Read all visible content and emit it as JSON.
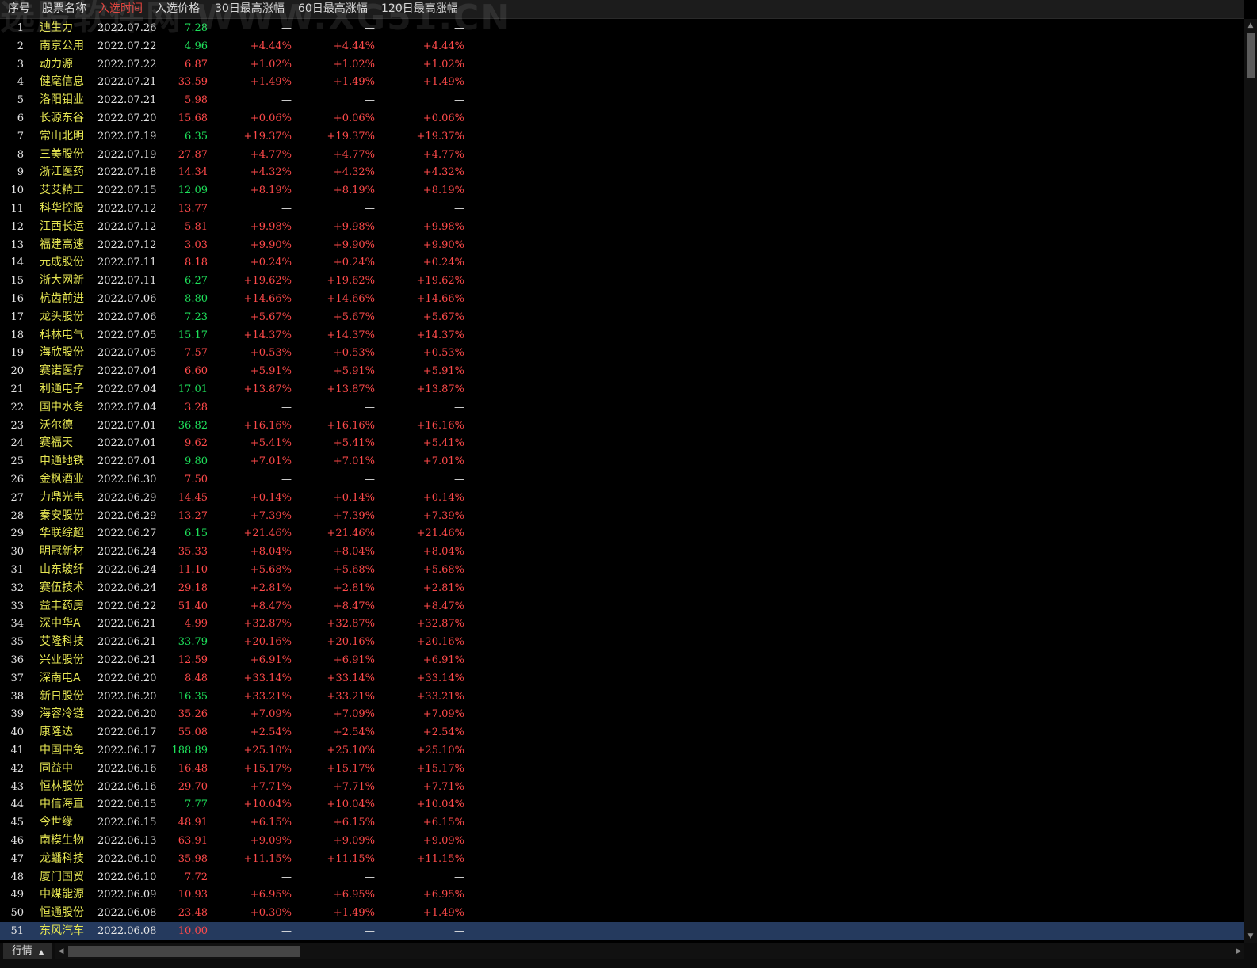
{
  "header": {
    "columns": [
      "序号",
      "股票名称",
      "入选时间",
      "入选价格",
      "30日最高涨幅",
      "60日最高涨幅",
      "120日最高涨幅"
    ],
    "active_column": "入选时间"
  },
  "watermark": "选股软件网 WWW.XG51.CN",
  "rows": [
    {
      "idx": "1",
      "name": "迪生力",
      "date": "2022.07.26",
      "price": "7.28",
      "dir": "down",
      "r30": "—",
      "r60": "—",
      "r120": "—"
    },
    {
      "idx": "2",
      "name": "南京公用",
      "date": "2022.07.22",
      "price": "4.96",
      "dir": "down",
      "r30": "+4.44%",
      "r60": "+4.44%",
      "r120": "+4.44%"
    },
    {
      "idx": "3",
      "name": "动力源",
      "date": "2022.07.22",
      "price": "6.87",
      "dir": "up",
      "r30": "+1.02%",
      "r60": "+1.02%",
      "r120": "+1.02%"
    },
    {
      "idx": "4",
      "name": "健麾信息",
      "date": "2022.07.21",
      "price": "33.59",
      "dir": "up",
      "r30": "+1.49%",
      "r60": "+1.49%",
      "r120": "+1.49%"
    },
    {
      "idx": "5",
      "name": "洛阳钼业",
      "date": "2022.07.21",
      "price": "5.98",
      "dir": "up",
      "r30": "—",
      "r60": "—",
      "r120": "—"
    },
    {
      "idx": "6",
      "name": "长源东谷",
      "date": "2022.07.20",
      "price": "15.68",
      "dir": "up",
      "r30": "+0.06%",
      "r60": "+0.06%",
      "r120": "+0.06%"
    },
    {
      "idx": "7",
      "name": "常山北明",
      "date": "2022.07.19",
      "price": "6.35",
      "dir": "down",
      "r30": "+19.37%",
      "r60": "+19.37%",
      "r120": "+19.37%"
    },
    {
      "idx": "8",
      "name": "三美股份",
      "date": "2022.07.19",
      "price": "27.87",
      "dir": "up",
      "r30": "+4.77%",
      "r60": "+4.77%",
      "r120": "+4.77%"
    },
    {
      "idx": "9",
      "name": "浙江医药",
      "date": "2022.07.18",
      "price": "14.34",
      "dir": "up",
      "r30": "+4.32%",
      "r60": "+4.32%",
      "r120": "+4.32%"
    },
    {
      "idx": "10",
      "name": "艾艾精工",
      "date": "2022.07.15",
      "price": "12.09",
      "dir": "down",
      "r30": "+8.19%",
      "r60": "+8.19%",
      "r120": "+8.19%"
    },
    {
      "idx": "11",
      "name": "科华控股",
      "date": "2022.07.12",
      "price": "13.77",
      "dir": "up",
      "r30": "—",
      "r60": "—",
      "r120": "—"
    },
    {
      "idx": "12",
      "name": "江西长运",
      "date": "2022.07.12",
      "price": "5.81",
      "dir": "up",
      "r30": "+9.98%",
      "r60": "+9.98%",
      "r120": "+9.98%"
    },
    {
      "idx": "13",
      "name": "福建高速",
      "date": "2022.07.12",
      "price": "3.03",
      "dir": "up",
      "r30": "+9.90%",
      "r60": "+9.90%",
      "r120": "+9.90%"
    },
    {
      "idx": "14",
      "name": "元成股份",
      "date": "2022.07.11",
      "price": "8.18",
      "dir": "up",
      "r30": "+0.24%",
      "r60": "+0.24%",
      "r120": "+0.24%"
    },
    {
      "idx": "15",
      "name": "浙大网新",
      "date": "2022.07.11",
      "price": "6.27",
      "dir": "down",
      "r30": "+19.62%",
      "r60": "+19.62%",
      "r120": "+19.62%"
    },
    {
      "idx": "16",
      "name": "杭齿前进",
      "date": "2022.07.06",
      "price": "8.80",
      "dir": "down",
      "r30": "+14.66%",
      "r60": "+14.66%",
      "r120": "+14.66%"
    },
    {
      "idx": "17",
      "name": "龙头股份",
      "date": "2022.07.06",
      "price": "7.23",
      "dir": "down",
      "r30": "+5.67%",
      "r60": "+5.67%",
      "r120": "+5.67%"
    },
    {
      "idx": "18",
      "name": "科林电气",
      "date": "2022.07.05",
      "price": "15.17",
      "dir": "down",
      "r30": "+14.37%",
      "r60": "+14.37%",
      "r120": "+14.37%"
    },
    {
      "idx": "19",
      "name": "海欣股份",
      "date": "2022.07.05",
      "price": "7.57",
      "dir": "up",
      "r30": "+0.53%",
      "r60": "+0.53%",
      "r120": "+0.53%"
    },
    {
      "idx": "20",
      "name": "赛诺医疗",
      "date": "2022.07.04",
      "price": "6.60",
      "dir": "up",
      "r30": "+5.91%",
      "r60": "+5.91%",
      "r120": "+5.91%"
    },
    {
      "idx": "21",
      "name": "利通电子",
      "date": "2022.07.04",
      "price": "17.01",
      "dir": "down",
      "r30": "+13.87%",
      "r60": "+13.87%",
      "r120": "+13.87%"
    },
    {
      "idx": "22",
      "name": "国中水务",
      "date": "2022.07.04",
      "price": "3.28",
      "dir": "up",
      "r30": "—",
      "r60": "—",
      "r120": "—"
    },
    {
      "idx": "23",
      "name": "沃尔德",
      "date": "2022.07.01",
      "price": "36.82",
      "dir": "down",
      "r30": "+16.16%",
      "r60": "+16.16%",
      "r120": "+16.16%"
    },
    {
      "idx": "24",
      "name": "赛福天",
      "date": "2022.07.01",
      "price": "9.62",
      "dir": "up",
      "r30": "+5.41%",
      "r60": "+5.41%",
      "r120": "+5.41%"
    },
    {
      "idx": "25",
      "name": "申通地铁",
      "date": "2022.07.01",
      "price": "9.80",
      "dir": "down",
      "r30": "+7.01%",
      "r60": "+7.01%",
      "r120": "+7.01%"
    },
    {
      "idx": "26",
      "name": "金枫酒业",
      "date": "2022.06.30",
      "price": "7.50",
      "dir": "up",
      "r30": "—",
      "r60": "—",
      "r120": "—"
    },
    {
      "idx": "27",
      "name": "力鼎光电",
      "date": "2022.06.29",
      "price": "14.45",
      "dir": "up",
      "r30": "+0.14%",
      "r60": "+0.14%",
      "r120": "+0.14%"
    },
    {
      "idx": "28",
      "name": "秦安股份",
      "date": "2022.06.29",
      "price": "13.27",
      "dir": "up",
      "r30": "+7.39%",
      "r60": "+7.39%",
      "r120": "+7.39%"
    },
    {
      "idx": "29",
      "name": "华联综超",
      "date": "2022.06.27",
      "price": "6.15",
      "dir": "down",
      "r30": "+21.46%",
      "r60": "+21.46%",
      "r120": "+21.46%"
    },
    {
      "idx": "30",
      "name": "明冠新材",
      "date": "2022.06.24",
      "price": "35.33",
      "dir": "up",
      "r30": "+8.04%",
      "r60": "+8.04%",
      "r120": "+8.04%"
    },
    {
      "idx": "31",
      "name": "山东玻纤",
      "date": "2022.06.24",
      "price": "11.10",
      "dir": "up",
      "r30": "+5.68%",
      "r60": "+5.68%",
      "r120": "+5.68%"
    },
    {
      "idx": "32",
      "name": "赛伍技术",
      "date": "2022.06.24",
      "price": "29.18",
      "dir": "up",
      "r30": "+2.81%",
      "r60": "+2.81%",
      "r120": "+2.81%"
    },
    {
      "idx": "33",
      "name": "益丰药房",
      "date": "2022.06.22",
      "price": "51.40",
      "dir": "up",
      "r30": "+8.47%",
      "r60": "+8.47%",
      "r120": "+8.47%"
    },
    {
      "idx": "34",
      "name": "深中华A",
      "date": "2022.06.21",
      "price": "4.99",
      "dir": "up",
      "r30": "+32.87%",
      "r60": "+32.87%",
      "r120": "+32.87%"
    },
    {
      "idx": "35",
      "name": "艾隆科技",
      "date": "2022.06.21",
      "price": "33.79",
      "dir": "down",
      "r30": "+20.16%",
      "r60": "+20.16%",
      "r120": "+20.16%"
    },
    {
      "idx": "36",
      "name": "兴业股份",
      "date": "2022.06.21",
      "price": "12.59",
      "dir": "up",
      "r30": "+6.91%",
      "r60": "+6.91%",
      "r120": "+6.91%"
    },
    {
      "idx": "37",
      "name": "深南电A",
      "date": "2022.06.20",
      "price": "8.48",
      "dir": "up",
      "r30": "+33.14%",
      "r60": "+33.14%",
      "r120": "+33.14%"
    },
    {
      "idx": "38",
      "name": "新日股份",
      "date": "2022.06.20",
      "price": "16.35",
      "dir": "down",
      "r30": "+33.21%",
      "r60": "+33.21%",
      "r120": "+33.21%"
    },
    {
      "idx": "39",
      "name": "海容冷链",
      "date": "2022.06.20",
      "price": "35.26",
      "dir": "up",
      "r30": "+7.09%",
      "r60": "+7.09%",
      "r120": "+7.09%"
    },
    {
      "idx": "40",
      "name": "康隆达",
      "date": "2022.06.17",
      "price": "55.08",
      "dir": "up",
      "r30": "+2.54%",
      "r60": "+2.54%",
      "r120": "+2.54%"
    },
    {
      "idx": "41",
      "name": "中国中免",
      "date": "2022.06.17",
      "price": "188.89",
      "dir": "down",
      "r30": "+25.10%",
      "r60": "+25.10%",
      "r120": "+25.10%"
    },
    {
      "idx": "42",
      "name": "同益中",
      "date": "2022.06.16",
      "price": "16.48",
      "dir": "up",
      "r30": "+15.17%",
      "r60": "+15.17%",
      "r120": "+15.17%"
    },
    {
      "idx": "43",
      "name": "恒林股份",
      "date": "2022.06.16",
      "price": "29.70",
      "dir": "up",
      "r30": "+7.71%",
      "r60": "+7.71%",
      "r120": "+7.71%"
    },
    {
      "idx": "44",
      "name": "中信海直",
      "date": "2022.06.15",
      "price": "7.77",
      "dir": "down",
      "r30": "+10.04%",
      "r60": "+10.04%",
      "r120": "+10.04%"
    },
    {
      "idx": "45",
      "name": "今世缘",
      "date": "2022.06.15",
      "price": "48.91",
      "dir": "up",
      "r30": "+6.15%",
      "r60": "+6.15%",
      "r120": "+6.15%"
    },
    {
      "idx": "46",
      "name": "南模生物",
      "date": "2022.06.13",
      "price": "63.91",
      "dir": "up",
      "r30": "+9.09%",
      "r60": "+9.09%",
      "r120": "+9.09%"
    },
    {
      "idx": "47",
      "name": "龙蟠科技",
      "date": "2022.06.10",
      "price": "35.98",
      "dir": "up",
      "r30": "+11.15%",
      "r60": "+11.15%",
      "r120": "+11.15%"
    },
    {
      "idx": "48",
      "name": "厦门国贸",
      "date": "2022.06.10",
      "price": "7.72",
      "dir": "up",
      "r30": "—",
      "r60": "—",
      "r120": "—"
    },
    {
      "idx": "49",
      "name": "中煤能源",
      "date": "2022.06.09",
      "price": "10.93",
      "dir": "up",
      "r30": "+6.95%",
      "r60": "+6.95%",
      "r120": "+6.95%"
    },
    {
      "idx": "50",
      "name": "恒通股份",
      "date": "2022.06.08",
      "price": "23.48",
      "dir": "up",
      "r30": "+0.30%",
      "r60": "+1.49%",
      "r120": "+1.49%"
    },
    {
      "idx": "51",
      "name": "东风汽车",
      "date": "2022.06.08",
      "price": "10.00",
      "dir": "up",
      "r30": "—",
      "r60": "—",
      "r120": "—",
      "selected": true
    }
  ],
  "footer": {
    "tab_label": "行情",
    "tab_arrow_icon": "triangle-up-icon"
  },
  "colors": {
    "up": "#ff4a4a",
    "down": "#1ee05a",
    "name": "#e5e552",
    "selected_row": "#253a5e",
    "active_header": "#e0403a"
  }
}
